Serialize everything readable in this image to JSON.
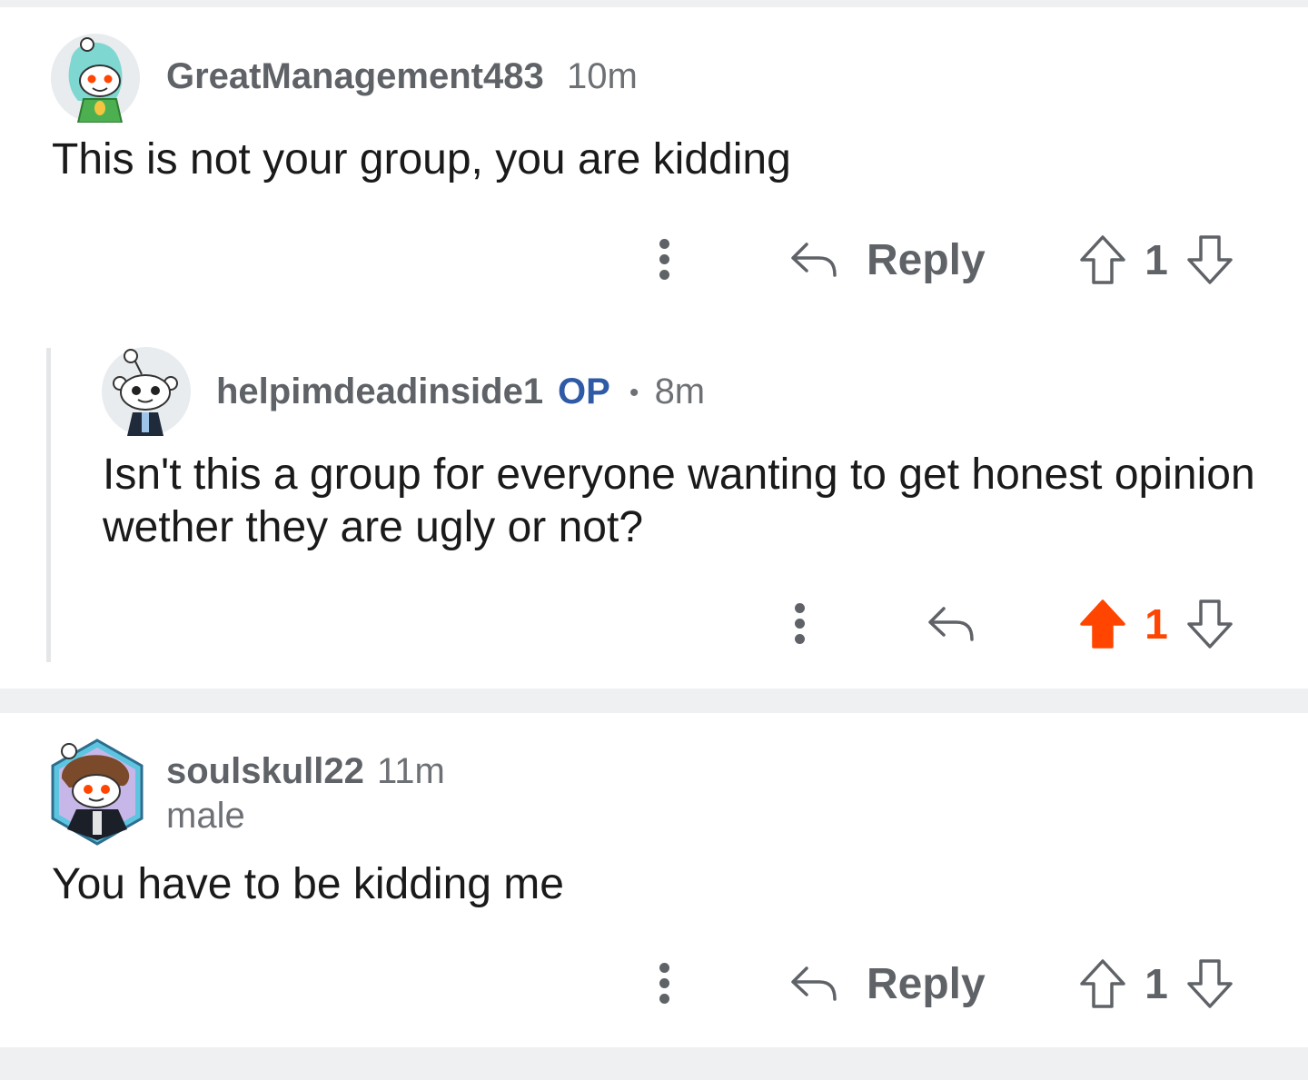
{
  "comments": [
    {
      "username": "GreatManagement483",
      "time": "10m",
      "body": "This is not your group, you are kidding",
      "reply_label": "Reply",
      "score": "1",
      "upvoted": false
    },
    {
      "username": "helpimdeadinside1",
      "op_badge": "OP",
      "separator": "•",
      "time": "8m",
      "body": "Isn't this a group for everyone wanting to get honest opinion wether they are ugly or not?",
      "score": "1",
      "upvoted": true
    },
    {
      "username": "soulskull22",
      "time": "11m",
      "flair": "male",
      "body": "You have to be kidding me",
      "reply_label": "Reply",
      "score": "1",
      "upvoted": false
    }
  ],
  "colors": {
    "upvote_active": "#ff4500",
    "op_badge": "#2f5aa6",
    "divider_band": "#eef0f2"
  },
  "icons": [
    "more-options-icon",
    "reply-icon",
    "upvote-icon",
    "downvote-icon"
  ]
}
